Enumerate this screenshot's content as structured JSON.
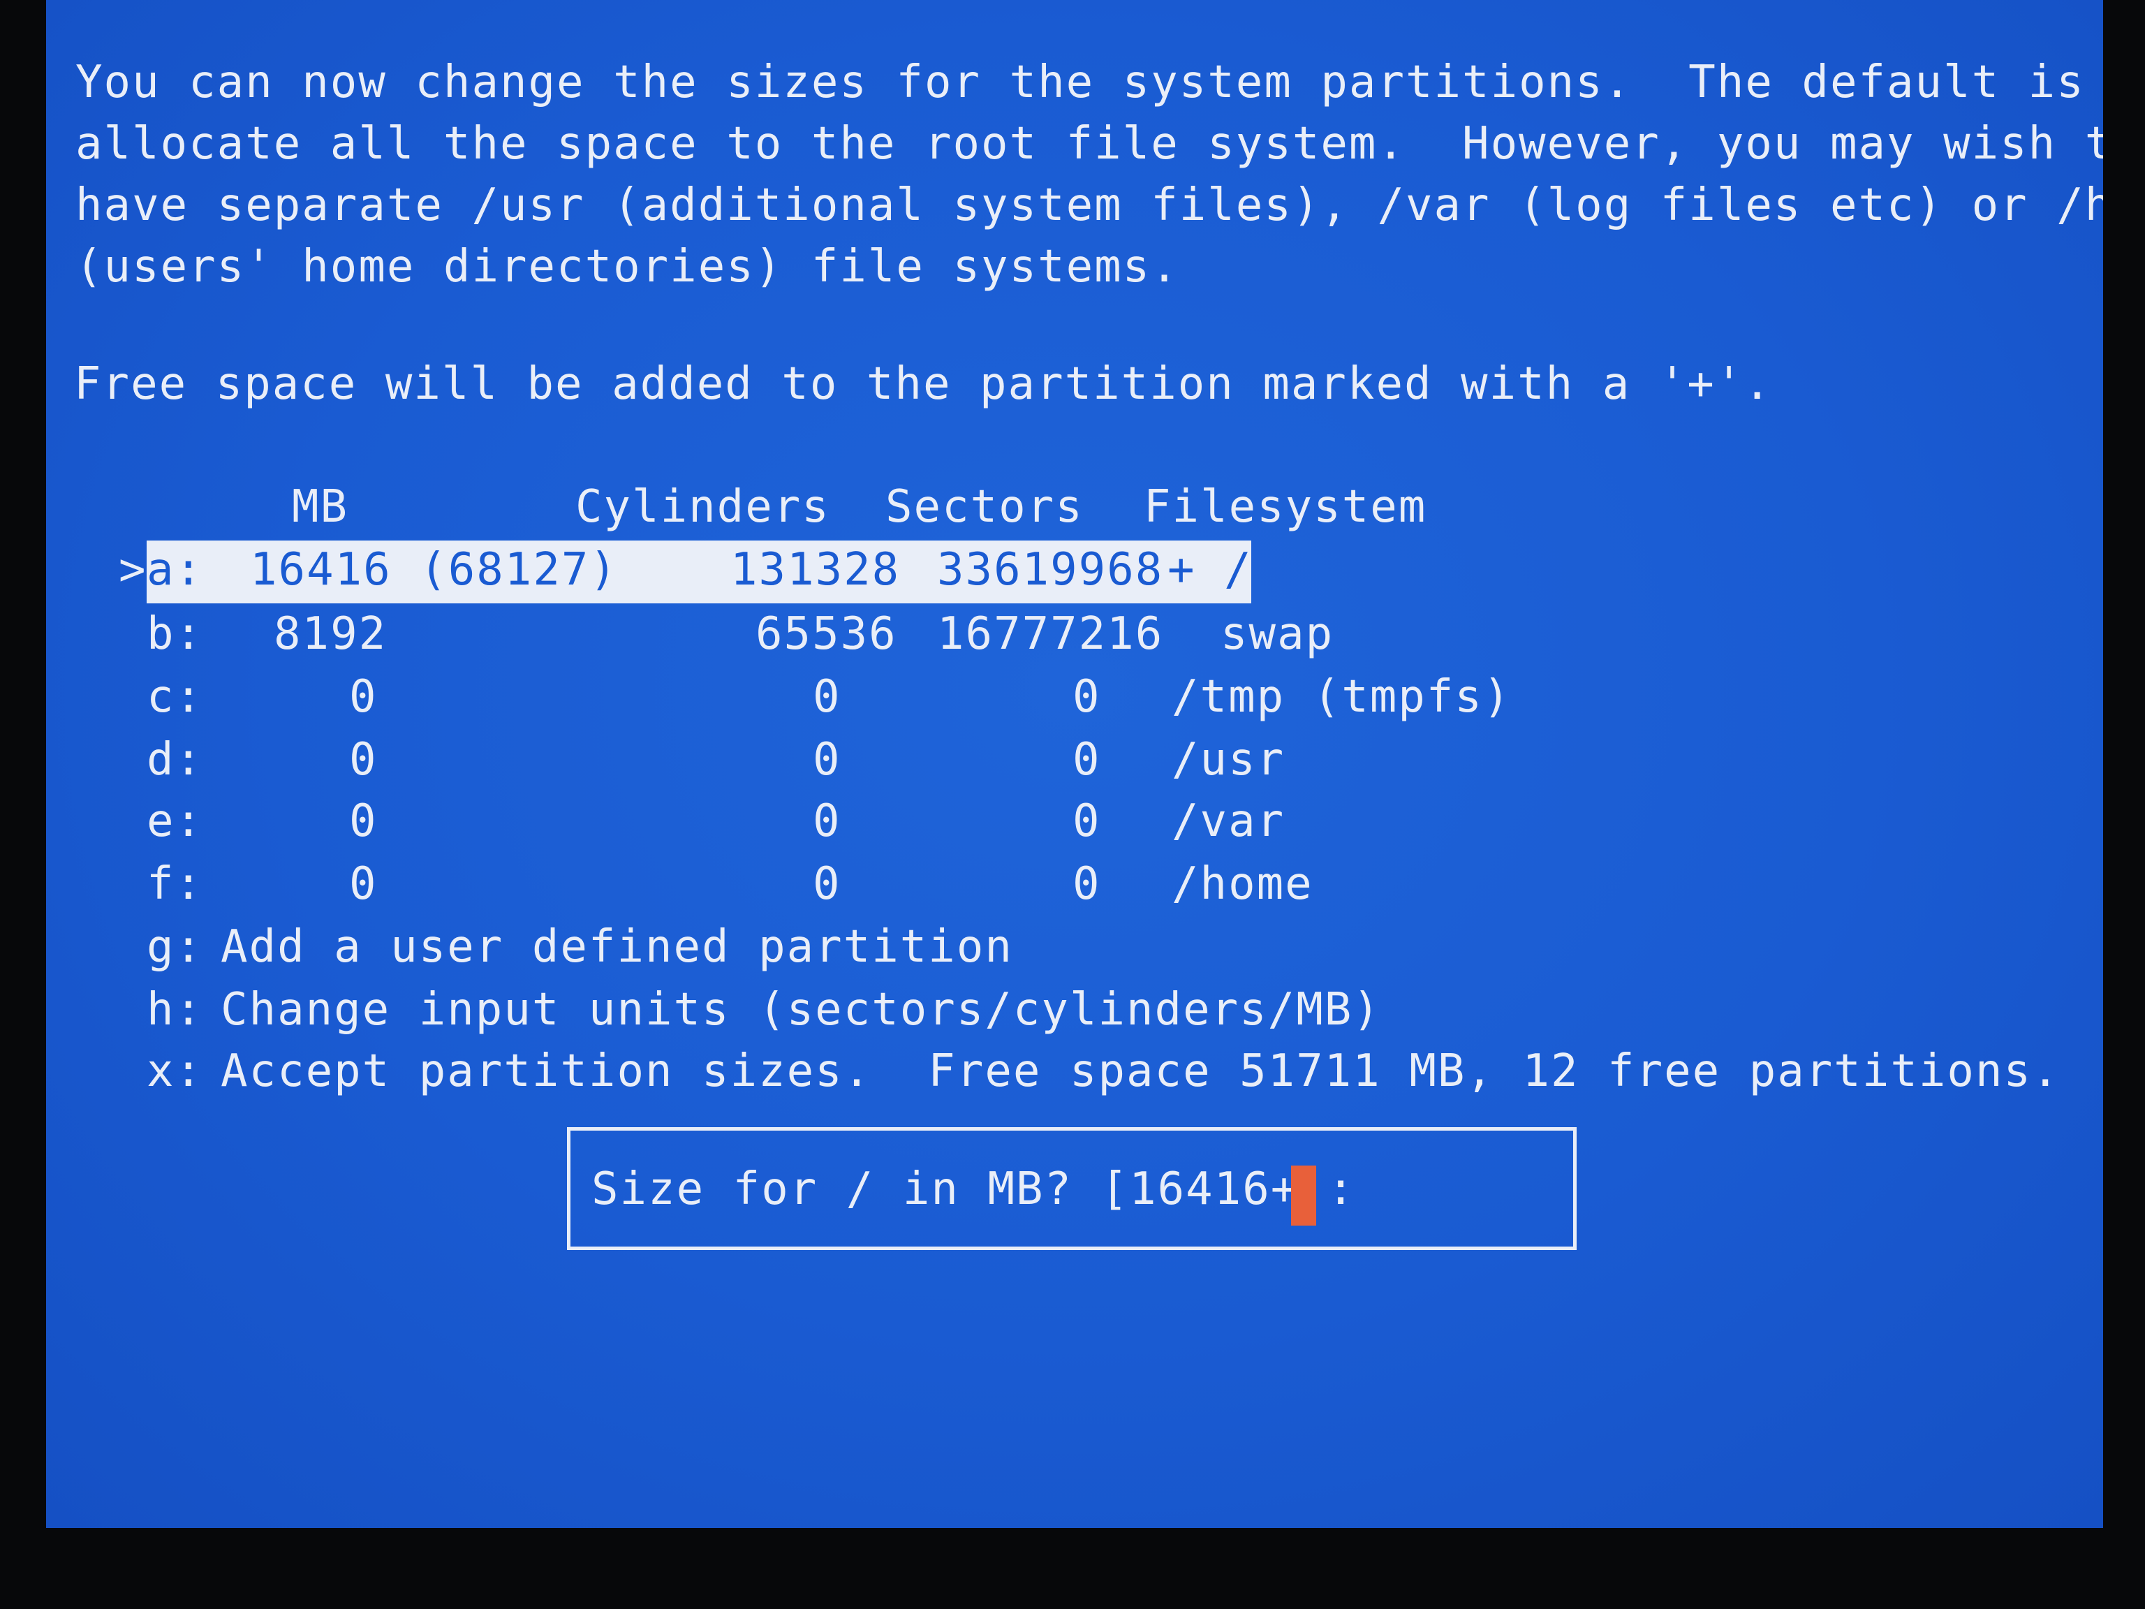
{
  "intro": {
    "lines": [
      "You can now change the sizes for the system partitions.  The default is to",
      "allocate all the space to the root file system.  However, you may wish to",
      "have separate /usr (additional system files), /var (log files etc) or /home",
      "(users' home directories) file systems."
    ]
  },
  "free_space_note": "Free space will be added to the partition marked with a '+'.",
  "table": {
    "headers": {
      "mb": "MB",
      "cylinders": "Cylinders",
      "sectors": "Sectors",
      "filesystem": "Filesystem"
    },
    "selected_marker": ">",
    "rows": [
      {
        "key": "a:",
        "mb": "16416 (68127)",
        "cylinders": "131328",
        "sectors": "33619968",
        "filesystem": "+ /"
      },
      {
        "key": "b:",
        "mb": "8192",
        "cylinders": "65536",
        "sectors": "16777216",
        "filesystem": "swap"
      },
      {
        "key": "c:",
        "mb": "0",
        "cylinders": "0",
        "sectors": "0",
        "filesystem": "/tmp (tmpfs)"
      },
      {
        "key": "d:",
        "mb": "0",
        "cylinders": "0",
        "sectors": "0",
        "filesystem": "/usr"
      },
      {
        "key": "e:",
        "mb": "0",
        "cylinders": "0",
        "sectors": "0",
        "filesystem": "/var"
      },
      {
        "key": "f:",
        "mb": "0",
        "cylinders": "0",
        "sectors": "0",
        "filesystem": "/home"
      }
    ]
  },
  "menu": [
    {
      "key": "g:",
      "label": "Add a user defined partition"
    },
    {
      "key": "h:",
      "label": "Change input units (sectors/cylinders/MB)"
    },
    {
      "key": "x:",
      "label": "Accept partition sizes.  Free space 51711 MB, 12 free partitions."
    }
  ],
  "prompt": {
    "text": "Size for / in MB? [16416+]:",
    "cursor_color": "#e8603a"
  },
  "colors": {
    "background": "#1a5bd2",
    "foreground": "#e9eef8"
  }
}
